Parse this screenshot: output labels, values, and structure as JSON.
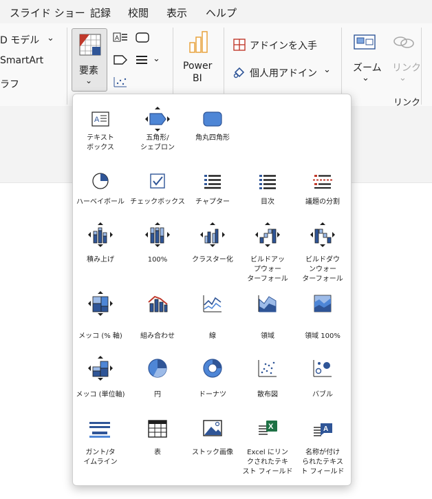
{
  "menu": {
    "slideshow": "スライド ショー",
    "record": "記録",
    "review": "校閲",
    "view": "表示",
    "help": "ヘルプ"
  },
  "ribbon": {
    "model3d": "D モデル",
    "smartart": "SmartArt",
    "graph": "ラフ",
    "elements": "要素",
    "powerbi_line1": "Power",
    "powerbi_line2": "BI",
    "addin_get": "アドインを入手",
    "addin_personal": "個人用アドイン",
    "zoom": "ズーム",
    "link": "リンク",
    "link_group": "リンク"
  },
  "gallery": {
    "row1": [
      "テキスト\nボックス",
      "五角形/\nシェブロン",
      "角丸四角形"
    ],
    "row2": [
      "ハーベイボール",
      "チェックボックス",
      "チャプター",
      "目次",
      "議題の分割"
    ],
    "row3": [
      "積み上げ",
      "100%",
      "クラスター化",
      "ビルドアッ\nプウォー\nターフォール",
      "ビルドダウ\nンウォー\nターフォール"
    ],
    "row4": [
      "メッコ (% 軸)",
      "組み合わせ",
      "線",
      "領域",
      "領域 100%"
    ],
    "row5": [
      "メッコ (単位軸)",
      "円",
      "ドーナツ",
      "散布図",
      "バブル"
    ],
    "row6": [
      "ガント/タ\nイムライン",
      "表",
      "ストック画像",
      "Excel にリン\nクされたテキ\nスト フィールド",
      "名称が付け\nられたテキス\nト フィールド"
    ]
  },
  "colors": {
    "accent_blue": "#2f5597",
    "light_blue": "#4e86d6",
    "red": "#c0392b",
    "green": "#1e7145"
  }
}
